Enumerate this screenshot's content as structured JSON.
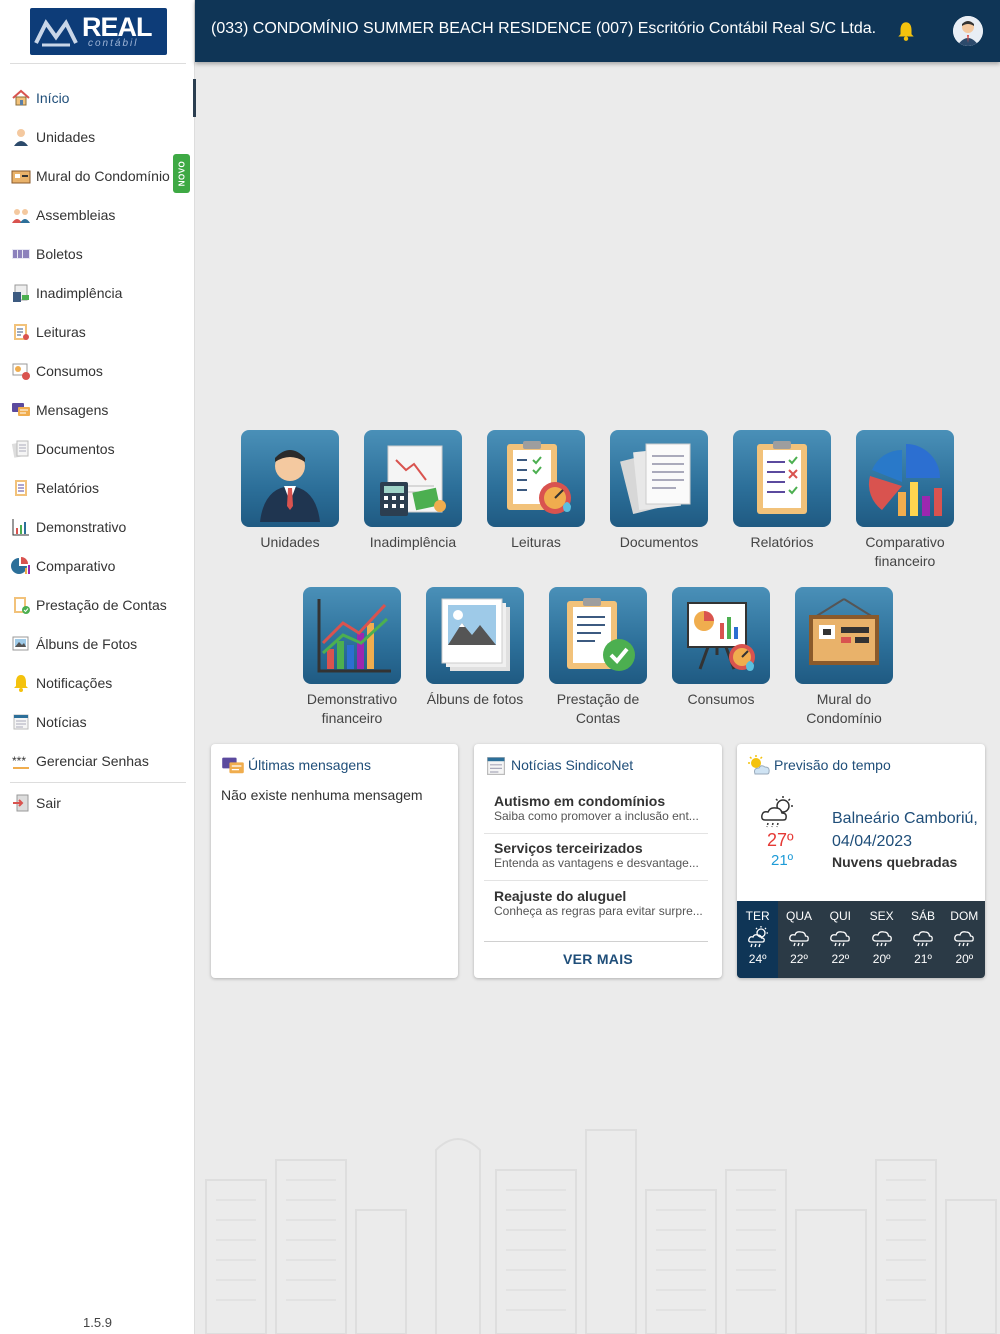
{
  "app": {
    "logo_text": "REAL",
    "logo_sub": "contábil",
    "version": "1.5.9"
  },
  "header": {
    "title": "(033) CONDOMÍNIO SUMMER BEACH RESIDENCE  (007) Escritório Contábil Real S/C Ltda."
  },
  "sidebar": {
    "items": [
      {
        "label": "Início"
      },
      {
        "label": "Unidades"
      },
      {
        "label": "Mural do Condomínio",
        "badge": "NOVO"
      },
      {
        "label": "Assembleias"
      },
      {
        "label": "Boletos"
      },
      {
        "label": "Inadimplência"
      },
      {
        "label": "Leituras"
      },
      {
        "label": "Consumos"
      },
      {
        "label": "Mensagens"
      },
      {
        "label": "Documentos"
      },
      {
        "label": "Relatórios"
      },
      {
        "label": "Demonstrativo"
      },
      {
        "label": "Comparativo"
      },
      {
        "label": "Prestação de Contas"
      },
      {
        "label": "Álbuns de Fotos"
      },
      {
        "label": "Notificações"
      },
      {
        "label": "Notícias"
      },
      {
        "label": "Gerenciar Senhas"
      }
    ],
    "logout": "Sair"
  },
  "tiles": [
    {
      "label": "Unidades"
    },
    {
      "label": "Inadimplência"
    },
    {
      "label": "Leituras"
    },
    {
      "label": "Documentos"
    },
    {
      "label": "Relatórios"
    },
    {
      "label": "Comparativo financeiro"
    },
    {
      "label": "Demonstrativo financeiro"
    },
    {
      "label": "Álbuns de fotos"
    },
    {
      "label": "Prestação de Contas"
    },
    {
      "label": "Consumos"
    },
    {
      "label": "Mural do Condomínio"
    }
  ],
  "messages_card": {
    "title": "Últimas mensagens",
    "empty": "Não existe nenhuma mensagem"
  },
  "news_card": {
    "title": "Notícias SindicoNet",
    "items": [
      {
        "title": "Autismo em condomínios",
        "summary": "Saiba como promover a inclusão ent..."
      },
      {
        "title": "Serviços terceirizados",
        "summary": "Entenda as vantagens e desvantage..."
      },
      {
        "title": "Reajuste do aluguel",
        "summary": "Conheça as regras para evitar surpre..."
      }
    ],
    "more": "VER MAIS"
  },
  "weather_card": {
    "title": "Previsão do tempo",
    "city": "Balneário Camboriú,",
    "date": "04/04/2023",
    "condition": "Nuvens quebradas",
    "max": "27º",
    "min": "21º",
    "forecast": [
      {
        "day": "TER",
        "temp": "24º",
        "icon": "partly-cloudy-rain-icon"
      },
      {
        "day": "QUA",
        "temp": "22º",
        "icon": "cloud-rain-icon"
      },
      {
        "day": "QUI",
        "temp": "22º",
        "icon": "cloud-rain-icon"
      },
      {
        "day": "SEX",
        "temp": "20º",
        "icon": "cloud-rain-icon"
      },
      {
        "day": "SÁB",
        "temp": "21º",
        "icon": "cloud-rain-icon"
      },
      {
        "day": "DOM",
        "temp": "20º",
        "icon": "cloud-rain-icon"
      }
    ]
  },
  "colors": {
    "header_bg": "#0f3556",
    "tile_bg": "#2c6f99",
    "accent": "#1f4e79",
    "badge_green": "#3ea944"
  }
}
